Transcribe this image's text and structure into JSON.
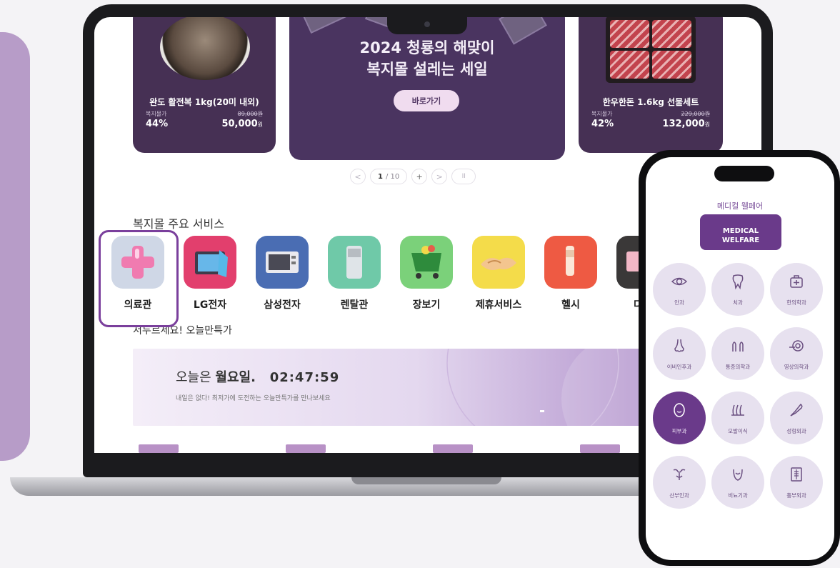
{
  "banner": {
    "left": {
      "name": "완도 활전복 1kg(20미 내외)",
      "label": "복지몰가",
      "original_price": "89,000원",
      "discount": "44%",
      "price": "50,000",
      "unit": "원"
    },
    "mid": {
      "title_line1": "2024 청룡의 해맞이",
      "title_line2": "복지몰 설레는 세일",
      "button": "바로가기"
    },
    "right": {
      "name": "한우한돈 1.6kg 선물세트",
      "label": "복지몰가",
      "original_price": "229,000원",
      "discount": "42%",
      "price": "132,000",
      "unit": "원"
    }
  },
  "pager": {
    "prev": "<",
    "current": "1",
    "total": "/ 10",
    "add": "+",
    "next": ">",
    "pause": "II"
  },
  "services": {
    "title": "복지몰 주요 서비스",
    "items": [
      {
        "label": "의료관",
        "color": "#cfd7e6"
      },
      {
        "label": "LG전자",
        "color": "#e23f6d"
      },
      {
        "label": "삼성전자",
        "color": "#4a6db3"
      },
      {
        "label": "렌탈관",
        "color": "#6fc9a8"
      },
      {
        "label": "장보기",
        "color": "#7bd17a"
      },
      {
        "label": "제휴서비스",
        "color": "#f4dc4a"
      },
      {
        "label": "헬시",
        "color": "#ee5a43"
      },
      {
        "label": "다이",
        "color": "#3a3838"
      }
    ]
  },
  "today": {
    "title": "서두르세요! 오늘만특가",
    "prefix": "오늘은",
    "day": "월요일.",
    "time": "02:47:59",
    "sub": "내일은 없다! 최저가에 도전하는 오늘만특가를 만나보세요"
  },
  "phone": {
    "header_ko": "메디컬 웰페어",
    "button": "MEDICAL\nWELFARE",
    "depts": [
      {
        "label": "안과",
        "icon": "eye-icon"
      },
      {
        "label": "치과",
        "icon": "tooth-icon"
      },
      {
        "label": "한의학과",
        "icon": "medicine-box-icon"
      },
      {
        "label": "이비인후과",
        "icon": "nose-icon"
      },
      {
        "label": "통증의학과",
        "icon": "hands-icon"
      },
      {
        "label": "영상의학과",
        "icon": "scanner-icon"
      },
      {
        "label": "피부과",
        "icon": "face-icon"
      },
      {
        "label": "모발이식",
        "icon": "hair-icon"
      },
      {
        "label": "성형외과",
        "icon": "scalpel-icon"
      },
      {
        "label": "산부인과",
        "icon": "uterus-icon"
      },
      {
        "label": "비뇨기과",
        "icon": "bladder-icon"
      },
      {
        "label": "흉부외과",
        "icon": "xray-icon"
      }
    ]
  }
}
